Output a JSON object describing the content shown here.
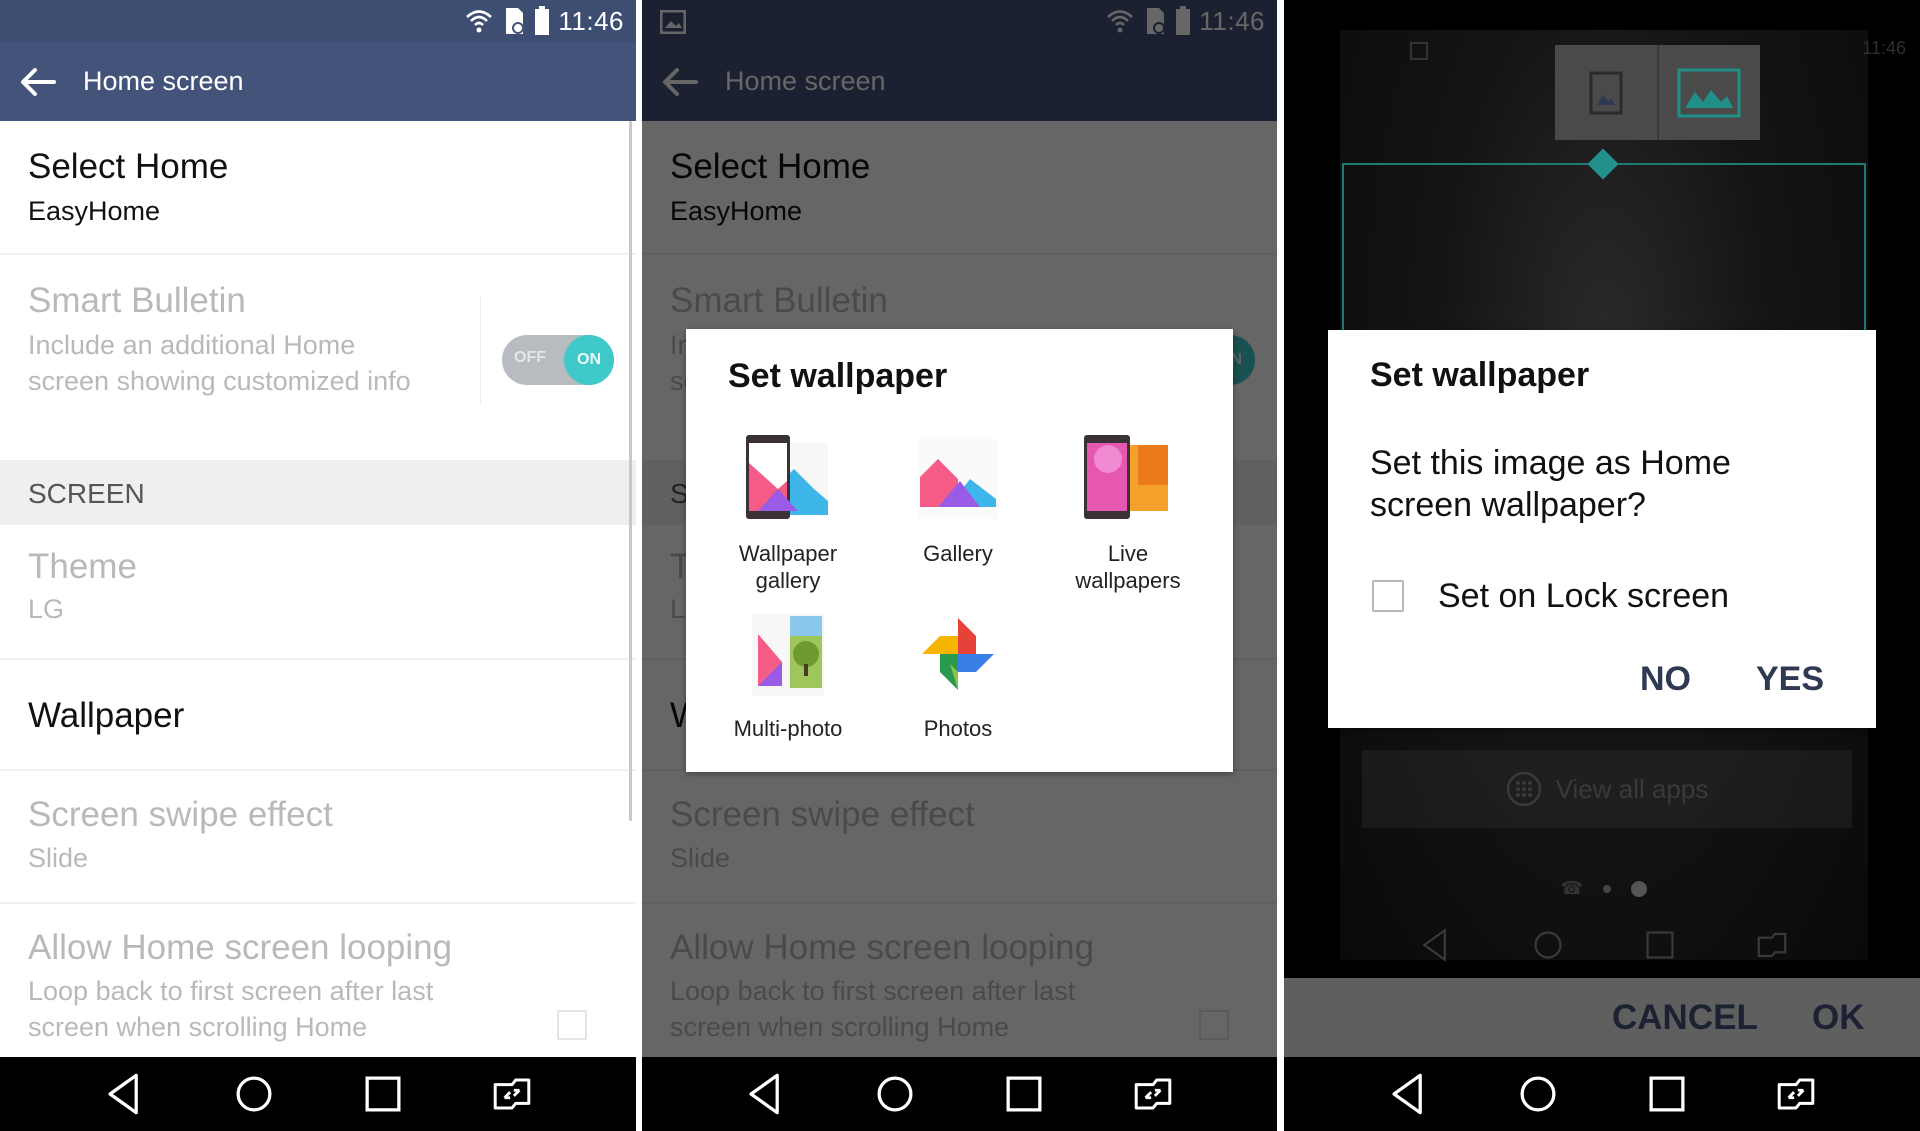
{
  "status_bar": {
    "time": "11:46",
    "icons": [
      "wifi-icon",
      "sd-card-icon",
      "battery-icon"
    ]
  },
  "panels": [
    {
      "app_bar": {
        "title": "Home screen",
        "back_icon": "arrow-left-icon"
      },
      "settings": {
        "select_home": {
          "title": "Select Home",
          "value": "EasyHome"
        },
        "smart_bulletin": {
          "title": "Smart Bulletin",
          "description": "Include an additional Home screen showing customized info",
          "toggle": {
            "off_label": "OFF",
            "on_label": "ON",
            "state": "on"
          }
        },
        "section_screen": "SCREEN",
        "theme": {
          "title": "Theme",
          "value": "LG"
        },
        "wallpaper": {
          "title": "Wallpaper"
        },
        "swipe_effect": {
          "title": "Screen swipe effect",
          "value": "Slide"
        },
        "looping": {
          "title": "Allow Home screen looping",
          "description": "Loop back to first screen after last screen when scrolling Home",
          "checked": false
        }
      }
    },
    {
      "app_bar": {
        "title": "Home screen"
      },
      "notification_icon": "image-icon",
      "dialog": {
        "title": "Set wallpaper",
        "options": [
          {
            "label": "Wallpaper gallery",
            "icon": "wallpaper-gallery-icon"
          },
          {
            "label": "Gallery",
            "icon": "gallery-icon"
          },
          {
            "label": "Live wallpapers",
            "icon": "live-wallpapers-icon"
          },
          {
            "label": "Multi-photo",
            "icon": "multi-photo-icon"
          },
          {
            "label": "Photos",
            "icon": "photos-pinwheel-icon"
          }
        ]
      }
    },
    {
      "preview": {
        "view_all_apps": "View all apps",
        "mode_toggle": [
          "single-screen-icon",
          "scrolling-screen-icon"
        ],
        "selected_mode": 1
      },
      "dialog": {
        "title": "Set wallpaper",
        "message": "Set this image as Home screen wallpaper?",
        "checkbox_label": "Set on Lock screen",
        "checkbox_checked": false,
        "no_label": "NO",
        "yes_label": "YES"
      },
      "crop_bar": {
        "cancel_label": "CANCEL",
        "ok_label": "OK"
      }
    }
  ],
  "nav_bar": [
    "back-icon",
    "home-icon",
    "recents-icon",
    "dual-window-icon"
  ],
  "colors": {
    "app_bar": "#44537a",
    "accent_teal": "#3fc9c9",
    "button_text": "#2f3a52"
  }
}
